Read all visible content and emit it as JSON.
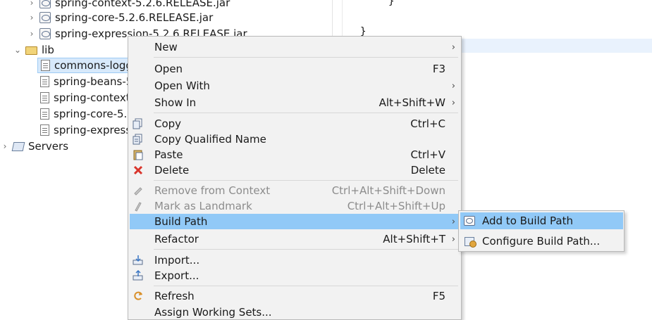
{
  "explorer": {
    "rows": [
      {
        "name": "spring-context-5.2.6.RELEASE.jar"
      },
      {
        "name": "spring-core-5.2.6.RELEASE.jar"
      },
      {
        "name": "spring-expression-5.2.6.RELEASE.jar"
      },
      {
        "name": "lib"
      },
      {
        "name": "commons-logg"
      },
      {
        "name": "spring-beans-5"
      },
      {
        "name": "spring-context"
      },
      {
        "name": "spring-core-5."
      },
      {
        "name": "spring-express"
      },
      {
        "name": "Servers"
      }
    ]
  },
  "editor": {
    "lines": [
      "}",
      "}"
    ]
  },
  "context_menu": {
    "items": [
      {
        "label": "New",
        "shortcut": "",
        "submenu": true
      },
      {
        "label": "Open",
        "shortcut": "F3",
        "submenu": false
      },
      {
        "label": "Open With",
        "shortcut": "",
        "submenu": true
      },
      {
        "label": "Show In",
        "shortcut": "Alt+Shift+W",
        "submenu": true
      },
      {
        "label": "Copy",
        "shortcut": "Ctrl+C",
        "submenu": false
      },
      {
        "label": "Copy Qualified Name",
        "shortcut": "",
        "submenu": false
      },
      {
        "label": "Paste",
        "shortcut": "Ctrl+V",
        "submenu": false
      },
      {
        "label": "Delete",
        "shortcut": "Delete",
        "submenu": false
      },
      {
        "label": "Remove from Context",
        "shortcut": "Ctrl+Alt+Shift+Down",
        "submenu": false
      },
      {
        "label": "Mark as Landmark",
        "shortcut": "Ctrl+Alt+Shift+Up",
        "submenu": false
      },
      {
        "label": "Build Path",
        "shortcut": "",
        "submenu": true
      },
      {
        "label": "Refactor",
        "shortcut": "Alt+Shift+T",
        "submenu": true
      },
      {
        "label": "Import...",
        "shortcut": "",
        "submenu": false
      },
      {
        "label": "Export...",
        "shortcut": "",
        "submenu": false
      },
      {
        "label": "Refresh",
        "shortcut": "F5",
        "submenu": false
      },
      {
        "label": "Assign Working Sets...",
        "shortcut": "",
        "submenu": false
      }
    ],
    "submenu_arrow": "›"
  },
  "build_path_submenu": {
    "items": [
      {
        "label": "Add to Build Path",
        "icon": "jar-icon"
      },
      {
        "label": "Configure Build Path...",
        "icon": "configure-build-path-icon"
      }
    ]
  },
  "colors": {
    "highlight": "#91c9f7",
    "menu_bg": "#f2f2f2",
    "delete_icon": "#d9342b",
    "disabled_text": "#8c8c8c"
  }
}
